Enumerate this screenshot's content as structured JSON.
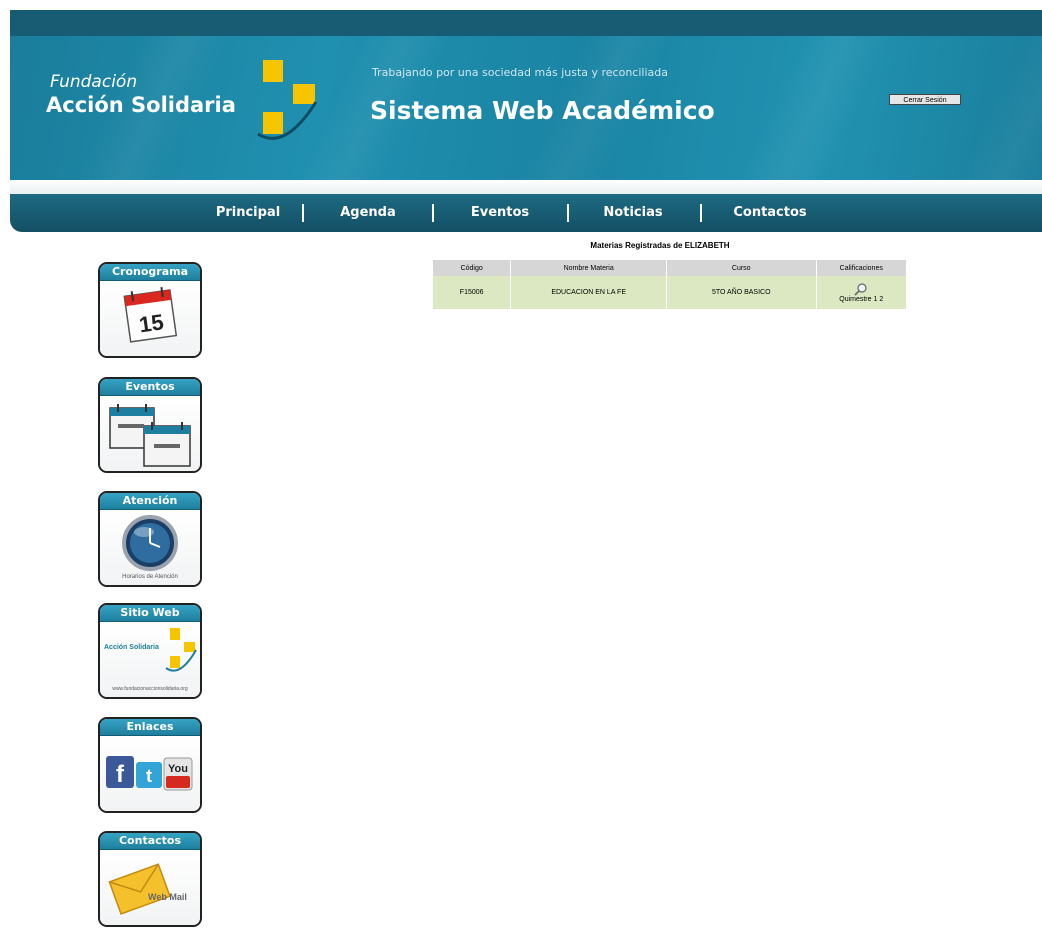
{
  "header": {
    "org_line1": "Fundación",
    "org_line2": "Acción Solidaria",
    "tagline": "Trabajando por una sociedad más justa y reconciliada",
    "system_title": "Sistema Web Académico",
    "logout_label": "Cerrar Sesión"
  },
  "nav": {
    "items": [
      {
        "label": "Principal"
      },
      {
        "label": "Agenda"
      },
      {
        "label": "Eventos"
      },
      {
        "label": "Noticias"
      },
      {
        "label": "Contactos"
      }
    ]
  },
  "sidebar": {
    "widgets": [
      {
        "title": "Cronograma",
        "icon": "calendar-icon",
        "calendar_day": "15"
      },
      {
        "title": "Eventos",
        "icon": "event-calendars-icon"
      },
      {
        "title": "Atención",
        "icon": "clock-icon",
        "caption": "Horarios de Atención"
      },
      {
        "title": "Sitio Web",
        "icon": "website-logo-icon",
        "logo_text": "Acción Solidaria",
        "url_text": "www.fundacionaccionsolidaria.org"
      },
      {
        "title": "Enlaces",
        "icon": "social-links-icon",
        "you_text": "You"
      },
      {
        "title": "Contactos",
        "icon": "webmail-icon",
        "webmail_text": "Web Mail"
      }
    ]
  },
  "main": {
    "subjects_title": "Materias Registradas de ELIZABETH",
    "table": {
      "headers": [
        "Código",
        "Nombre Materia",
        "Curso",
        "Calificaciones"
      ],
      "rows": [
        {
          "codigo": "F15006",
          "materia": "EDUCACION EN LA FE",
          "curso": "5TO AÑO BASICO",
          "calificaciones_label": "Quimestre",
          "q1": "1",
          "q2": "2"
        }
      ]
    }
  },
  "colors": {
    "banner": "#1f8aa9",
    "nav": "#175c73",
    "accent_yellow": "#f6c500",
    "table_header": "#d6d6d6",
    "table_row": "#dbe8c2"
  }
}
